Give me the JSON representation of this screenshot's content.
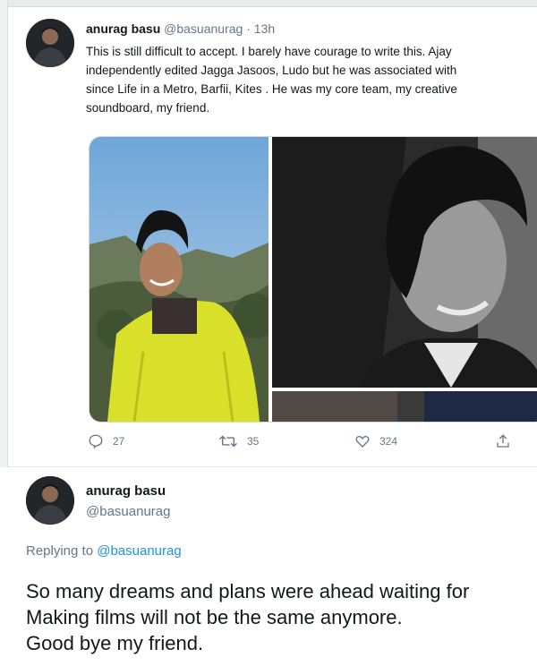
{
  "tweet1": {
    "author_name": "anurag basu",
    "author_handle": "@basuanurag",
    "separator": "·",
    "time": "13h",
    "text_lines": [
      "This is still difficult to accept. I barely have courage to write this. Ajay",
      "independently edited Jagga Jasoos, Ludo but he was associated with",
      "since Life in a Metro, Barfii, Kites . He was my core team, my creative",
      "soundboard, my friend."
    ],
    "actions": {
      "reply_count": "27",
      "retweet_count": "35",
      "like_count": "324"
    },
    "icons": {
      "reply": "reply-icon",
      "retweet": "retweet-icon",
      "like": "heart-icon",
      "share": "share-icon"
    }
  },
  "tweet2": {
    "author_name": "anurag basu",
    "author_handle": "@basuanurag",
    "replying_prefix": "Replying to",
    "replying_handle": "@basuanurag",
    "text_lines": [
      "So many dreams and plans were ahead waiting for",
      "Making films will not be the same anymore.",
      "Good bye my friend."
    ]
  },
  "colors": {
    "text_primary": "#14171a",
    "text_secondary": "#657786",
    "link": "#1b95e0",
    "border": "#e1e8ed"
  }
}
